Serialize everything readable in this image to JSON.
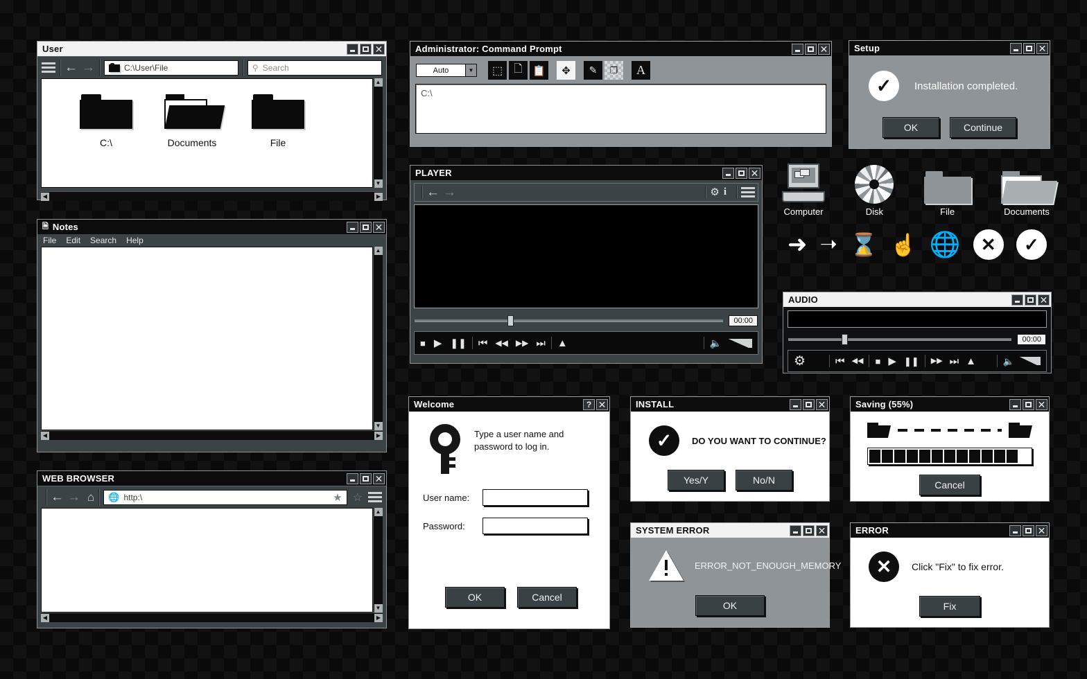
{
  "windows": {
    "user": {
      "title": "User",
      "path_value": "C:\\User\\File",
      "search_placeholder": "Search",
      "icons": [
        {
          "label": "C:\\",
          "icon": "folder-icon"
        },
        {
          "label": "Documents",
          "icon": "folder-open-icon"
        },
        {
          "label": "File",
          "icon": "folder-icon"
        }
      ]
    },
    "notes": {
      "title": "Notes",
      "menu": [
        "File",
        "Edit",
        "Search",
        "Help"
      ],
      "content": ""
    },
    "browser": {
      "title": "WEB BROWSER",
      "url_value": "http:\\",
      "content": ""
    },
    "cmd": {
      "title": "Administrator: Command Prompt",
      "dropdown_value": "Auto",
      "toolbar_icons": [
        "select-icon",
        "copy-icon",
        "paste-icon",
        "move-icon",
        "edit-icon",
        "window-icon",
        "font-icon"
      ],
      "console_text": "C:\\"
    },
    "player": {
      "title": "PLAYER",
      "time": "00:00",
      "transport": [
        "stop",
        "play",
        "pause",
        "prev",
        "rewind",
        "forward",
        "next",
        "eject"
      ],
      "toolbar_icons": [
        "back-arrow-icon",
        "forward-arrow-icon",
        "gear-icon",
        "info-icon",
        "hamburger-icon"
      ]
    },
    "audio": {
      "title": "AUDIO",
      "time": "00:00",
      "transport": [
        "prev",
        "rewind",
        "stop",
        "play",
        "pause",
        "forward",
        "next",
        "eject"
      ]
    }
  },
  "dialogs": {
    "setup": {
      "title": "Setup",
      "message": "Installation completed.",
      "buttons": [
        "OK",
        "Continue"
      ],
      "icon": "check-circle-icon"
    },
    "welcome": {
      "title": "Welcome",
      "message": "Type a user name and password to log in.",
      "username_label": "User name:",
      "password_label": "Password:",
      "username_value": "",
      "password_value": "",
      "buttons": [
        "OK",
        "Cancel"
      ],
      "icon": "key-icon",
      "titlebar_buttons": [
        "?",
        "X"
      ]
    },
    "install": {
      "title": "INSTALL",
      "message": "DO YOU WANT TO CONTINUE?",
      "buttons": [
        "Yes/Y",
        "No/N"
      ],
      "icon": "check-circle-icon"
    },
    "saving": {
      "title": "Saving (55%)",
      "percent": 55,
      "blocks_filled": 12,
      "blocks_total": 22,
      "buttons": [
        "Cancel"
      ]
    },
    "system_error": {
      "title": "SYSTEM ERROR",
      "message": "ERROR_NOT_ENOUGH_MEMORY",
      "buttons": [
        "OK"
      ],
      "icon": "warning-triangle-icon"
    },
    "error": {
      "title": "ERROR",
      "message": "Click \"Fix\" to fix error.",
      "buttons": [
        "Fix"
      ],
      "icon": "x-circle-icon"
    }
  },
  "icon_grid": {
    "row1": [
      {
        "label": "Computer",
        "icon": "computer-icon"
      },
      {
        "label": "Disk",
        "icon": "disk-icon"
      },
      {
        "label": "File",
        "icon": "folder-icon"
      },
      {
        "label": "Documents",
        "icon": "folder-open-icon"
      }
    ],
    "row2": [
      "cursor-arrow-icon",
      "cursor-outline-icon",
      "hourglass-icon",
      "hand-pointer-icon",
      "globe-icon",
      "x-circle-icon",
      "check-circle-icon"
    ]
  },
  "colors": {
    "chrome": "#3c4346",
    "titlebar_dark": "#0c0c0c",
    "titlebar_light": "#f2f2f2",
    "gray_dialog": "#8e9497"
  }
}
